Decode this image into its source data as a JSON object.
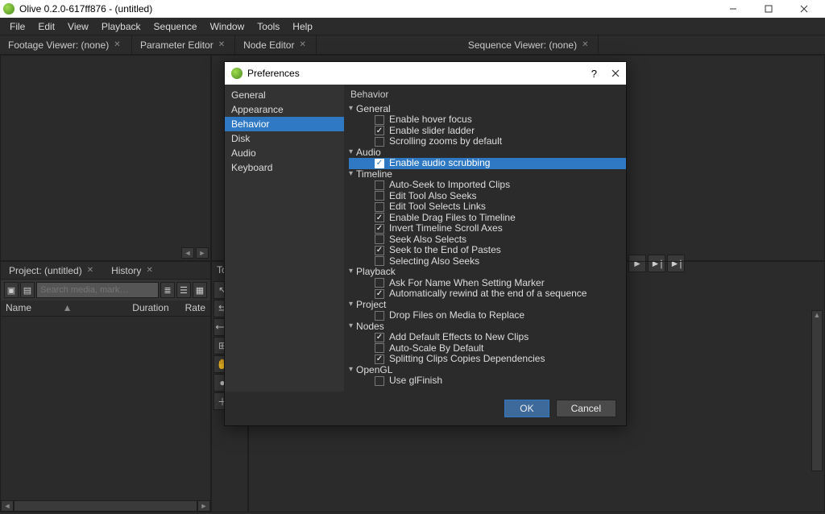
{
  "window": {
    "title": "Olive 0.2.0-617ff876 - (untitled)"
  },
  "menus": [
    "File",
    "Edit",
    "View",
    "Playback",
    "Sequence",
    "Window",
    "Tools",
    "Help"
  ],
  "top_tabs": [
    {
      "label": "Footage Viewer: (none)"
    },
    {
      "label": "Parameter Editor"
    },
    {
      "label": "Node Editor"
    },
    {
      "label": "Sequence Viewer: (none)"
    }
  ],
  "project": {
    "tab1": "Project: (untitled)",
    "tab2": "History",
    "search_placeholder": "Search media, mark…",
    "col1": "Name",
    "col2": "Duration",
    "col3": "Rate"
  },
  "tools_label": "Tools",
  "modal": {
    "title": "Preferences",
    "categories": [
      "General",
      "Appearance",
      "Behavior",
      "Disk",
      "Audio",
      "Keyboard"
    ],
    "selected_category": "Behavior",
    "tree_title": "Behavior",
    "groups": [
      {
        "name": "General",
        "items": [
          {
            "label": "Enable hover focus",
            "checked": false
          },
          {
            "label": "Enable slider ladder",
            "checked": true
          },
          {
            "label": "Scrolling zooms by default",
            "checked": false
          }
        ]
      },
      {
        "name": "Audio",
        "items": [
          {
            "label": "Enable audio scrubbing",
            "checked": true,
            "selected": true
          }
        ]
      },
      {
        "name": "Timeline",
        "items": [
          {
            "label": "Auto-Seek to Imported Clips",
            "checked": false
          },
          {
            "label": "Edit Tool Also Seeks",
            "checked": false
          },
          {
            "label": "Edit Tool Selects Links",
            "checked": false
          },
          {
            "label": "Enable Drag Files to Timeline",
            "checked": true
          },
          {
            "label": "Invert Timeline Scroll Axes",
            "checked": true
          },
          {
            "label": "Seek Also Selects",
            "checked": false
          },
          {
            "label": "Seek to the End of Pastes",
            "checked": true
          },
          {
            "label": "Selecting Also Seeks",
            "checked": false
          }
        ]
      },
      {
        "name": "Playback",
        "items": [
          {
            "label": "Ask For Name When Setting Marker",
            "checked": false
          },
          {
            "label": "Automatically rewind at the end of a sequence",
            "checked": true
          }
        ]
      },
      {
        "name": "Project",
        "items": [
          {
            "label": "Drop Files on Media to Replace",
            "checked": false
          }
        ]
      },
      {
        "name": "Nodes",
        "items": [
          {
            "label": "Add Default Effects to New Clips",
            "checked": true
          },
          {
            "label": "Auto-Scale By Default",
            "checked": false
          },
          {
            "label": "Splitting Clips Copies Dependencies",
            "checked": true
          }
        ]
      },
      {
        "name": "OpenGL",
        "items": [
          {
            "label": "Use glFinish",
            "checked": false
          }
        ]
      }
    ],
    "ok": "OK",
    "cancel": "Cancel"
  }
}
